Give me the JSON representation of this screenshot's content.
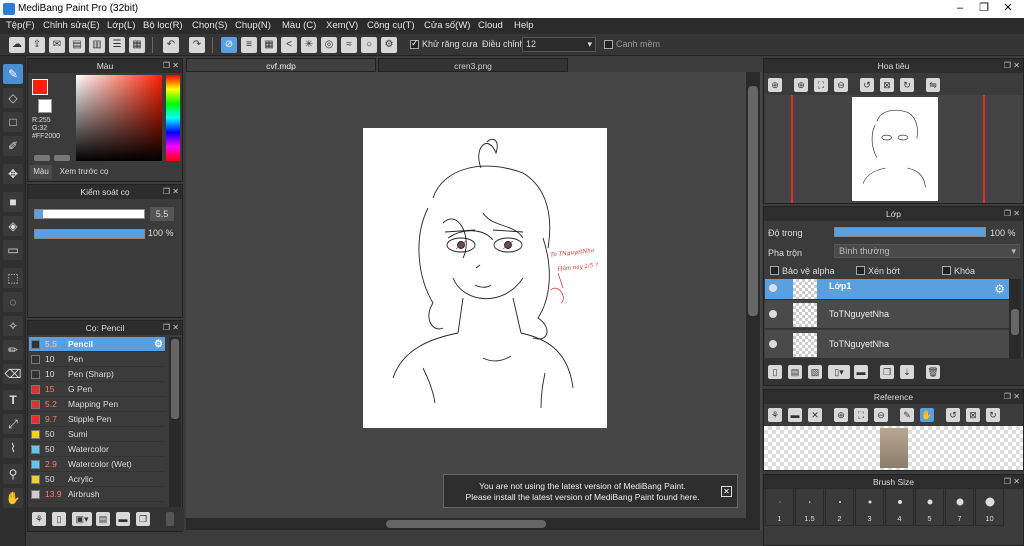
{
  "title": "MediBang Paint Pro (32bit)",
  "menu": [
    "Tệp(F)",
    "Chỉnh sửa(E)",
    "Lớp(L)",
    "Bộ lọc(R)",
    "Chọn(S)",
    "Chụp(N)",
    "Màu (C)",
    "Xem(V)",
    "Công cụ(T)",
    "Cửa số(W)",
    "Cloud",
    "Help"
  ],
  "toolbar": {
    "antialias_label": "Khử răng cưa",
    "adjust_label": "Điều chỉnh",
    "adjust_value": "12",
    "snap_label": "Canh mềm"
  },
  "color_panel": {
    "title": "Màu",
    "r": "R:255",
    "g": "G:32",
    "b": "B:0",
    "hex": "#FF2000",
    "tab_color": "Màu",
    "tab_preview": "Xem trước cọ",
    "main_color": "#FF2000"
  },
  "brush_control": {
    "title": "Kiểm soát cọ",
    "size": "5.5",
    "opacity": "100 %"
  },
  "brush_panel": {
    "title": "Cọ: Pencil",
    "items": [
      {
        "size": "5.5",
        "name": "Pencil",
        "color": "#333333"
      },
      {
        "size": "10",
        "name": "Pen",
        "color": "#333333"
      },
      {
        "size": "10",
        "name": "Pen (Sharp)",
        "color": "#333333"
      },
      {
        "size": "15",
        "name": "G Pen",
        "color": "#e03030"
      },
      {
        "size": "5.2",
        "name": "Mapping Pen",
        "color": "#e03030"
      },
      {
        "size": "9.7",
        "name": "Stipple Pen",
        "color": "#e03030"
      },
      {
        "size": "50",
        "name": "Sumi",
        "color": "#f0d020"
      },
      {
        "size": "50",
        "name": "Watercolor",
        "color": "#60c8f0"
      },
      {
        "size": "2.9",
        "name": "Watercolor (Wet)",
        "color": "#60c8f0"
      },
      {
        "size": "50",
        "name": "Acrylic",
        "color": "#f0d020"
      },
      {
        "size": "13.9",
        "name": "Airbrush",
        "color": "#cccccc"
      }
    ]
  },
  "tabs": [
    "cvf.mdp",
    "cren3.png"
  ],
  "canvas": {
    "annotation_line1": "To TNguyetNha",
    "annotation_line2": "Hôm nay 2/5 ?"
  },
  "notification": {
    "line1": "You are not using the latest version of MediBang Paint.",
    "line2": "Please install the latest version of MediBang Paint found here."
  },
  "navigator": {
    "title": "Hoa tiêu"
  },
  "layer_panel": {
    "title": "Lớp",
    "opacity_label": "Độ trong",
    "opacity_value": "100 %",
    "blend_label": "Pha trộn",
    "blend_value": "Bình thường",
    "protect_alpha": "Bảo vệ alpha",
    "clip": "Xén bớt",
    "lock": "Khóa",
    "layers": [
      "Lớp1",
      "ToTNguyetNha",
      "ToTNguyetNha"
    ]
  },
  "reference": {
    "title": "Reference"
  },
  "brush_size": {
    "title": "Brush Size",
    "sizes": [
      "1",
      "1.5",
      "2",
      "3",
      "4",
      "5",
      "7",
      "10"
    ]
  }
}
